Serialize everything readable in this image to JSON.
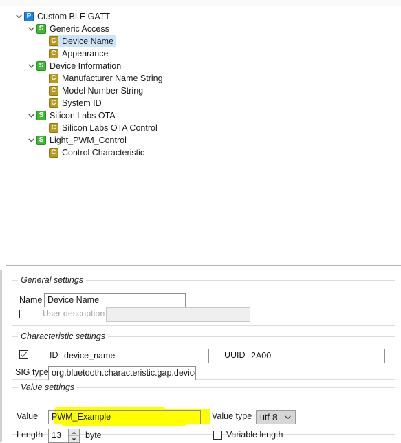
{
  "tree": {
    "name": "gatt-tree",
    "nodes": [
      {
        "label": "Custom BLE GATT",
        "icon": "profile-icon",
        "icon_glyph": "P",
        "depth": 0,
        "expanded": true,
        "has_children": true,
        "selected": false
      },
      {
        "label": "Generic Access",
        "icon": "service-icon",
        "icon_glyph": "S",
        "depth": 1,
        "expanded": true,
        "has_children": true,
        "selected": false
      },
      {
        "label": "Device Name",
        "icon": "characteristic-icon",
        "icon_glyph": "C",
        "depth": 2,
        "expanded": false,
        "has_children": false,
        "selected": true
      },
      {
        "label": "Appearance",
        "icon": "characteristic-icon",
        "icon_glyph": "C",
        "depth": 2,
        "expanded": false,
        "has_children": false,
        "selected": false
      },
      {
        "label": "Device Information",
        "icon": "service-icon",
        "icon_glyph": "S",
        "depth": 1,
        "expanded": true,
        "has_children": true,
        "selected": false
      },
      {
        "label": "Manufacturer Name String",
        "icon": "characteristic-icon",
        "icon_glyph": "C",
        "depth": 2,
        "expanded": false,
        "has_children": false,
        "selected": false
      },
      {
        "label": "Model Number String",
        "icon": "characteristic-icon",
        "icon_glyph": "C",
        "depth": 2,
        "expanded": false,
        "has_children": false,
        "selected": false
      },
      {
        "label": "System ID",
        "icon": "characteristic-icon",
        "icon_glyph": "C",
        "depth": 2,
        "expanded": false,
        "has_children": false,
        "selected": false
      },
      {
        "label": "Silicon Labs OTA",
        "icon": "service-icon",
        "icon_glyph": "S",
        "depth": 1,
        "expanded": true,
        "has_children": true,
        "selected": false
      },
      {
        "label": "Silicon Labs OTA Control",
        "icon": "characteristic-icon",
        "icon_glyph": "C",
        "depth": 2,
        "expanded": false,
        "has_children": false,
        "selected": false
      },
      {
        "label": "Light_PWM_Control",
        "icon": "service-icon",
        "icon_glyph": "S",
        "depth": 1,
        "expanded": true,
        "has_children": true,
        "selected": false
      },
      {
        "label": "Control Characteristic",
        "icon": "characteristic-icon",
        "icon_glyph": "C",
        "depth": 2,
        "expanded": false,
        "has_children": false,
        "selected": false
      }
    ]
  },
  "general_settings": {
    "legend": "General settings",
    "name_label": "Name",
    "name_value": "Device Name",
    "user_description_label": "User description",
    "user_description_value": "",
    "user_description_checked": false
  },
  "characteristic_settings": {
    "legend": "Characteristic settings",
    "id_checked": true,
    "id_label": "ID",
    "id_value": "device_name",
    "uuid_label": "UUID",
    "uuid_value": "2A00",
    "sig_type_label": "SIG type",
    "sig_type_value": "org.bluetooth.characteristic.gap.device_name"
  },
  "value_settings": {
    "legend": "Value settings",
    "value_label": "Value",
    "value_value": "PWM_Example",
    "value_type_label": "Value type",
    "value_type_value": "utf-8",
    "length_label": "Length",
    "length_value": "13",
    "length_unit": "byte",
    "variable_length_label": "Variable length",
    "variable_length_checked": false
  },
  "colors": {
    "profile_icon": "#1b80e8",
    "service_icon": "#3fb836",
    "characteristic_icon": "#b99b22",
    "selection": "#cce4f7",
    "highlighter": "#ffff00"
  }
}
